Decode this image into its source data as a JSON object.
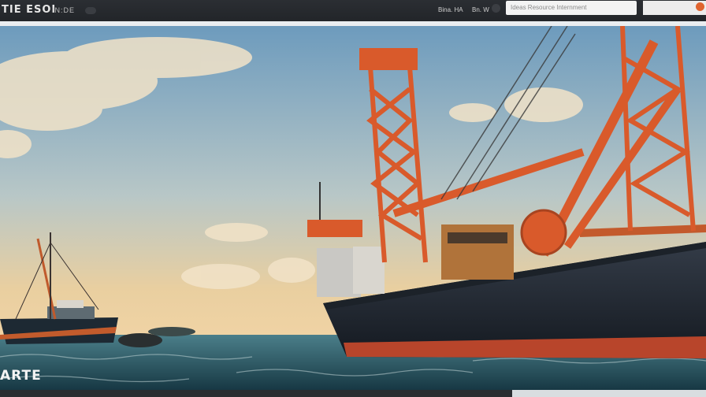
{
  "header": {
    "logo_text": "TIE ESOI",
    "logo_sub": "IN:DE",
    "nav_a": "Bina. HA",
    "nav_b": "Bn. W",
    "search_text": "Ideas Resource Internment"
  },
  "hero": {
    "caption": "ARTE",
    "image_alt": "Sunset seascape with a large orange-crane vessel and a small fishing boat"
  },
  "colors": {
    "accent": "#e0642f",
    "crane": "#d95a2b",
    "hull": "#262b33",
    "sea": "#2f5d6b"
  }
}
